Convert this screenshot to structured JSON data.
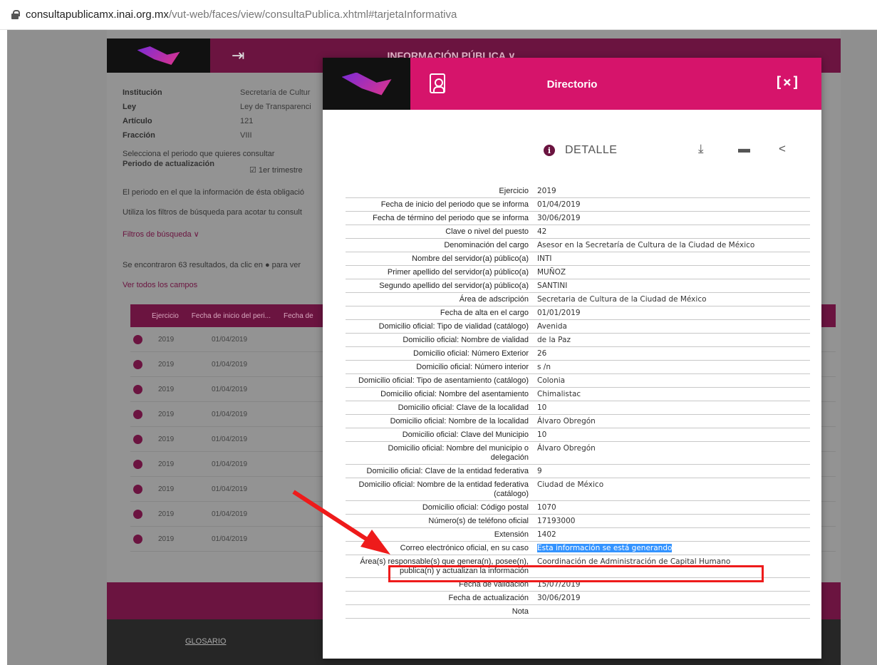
{
  "browser": {
    "url_host": "consultapublicamx.inai.org.mx",
    "url_path": "/vut-web/faces/view/consultaPublica.xhtml#tarjetaInformativa"
  },
  "background": {
    "nav_title": "INFORMACIÓN PÚBLICA ∨",
    "info_rows": [
      {
        "k": "Institución",
        "v": "Secretaría de Cultur"
      },
      {
        "k": "Ley",
        "v": "Ley de Transparenci"
      },
      {
        "k": "Artículo",
        "v": "121"
      },
      {
        "k": "Fracción",
        "v": "VIII"
      }
    ],
    "period_prompt": "Selecciona el periodo que quieres consultar",
    "period_label": "Periodo de actualización",
    "period_option": "1er trimestre",
    "obligation_text": "El periodo en el que la información de ésta obligació",
    "filters_hint": "Utiliza los filtros de búsqueda para acotar tu consult",
    "filters_link": "Filtros de búsqueda ∨",
    "results_text": "Se encontraron 63 resultados, da clic en ● para ver",
    "all_fields_link": "Ver todos los campos",
    "table_headers": [
      "Ejercicio",
      "Fecha de inicio del peri...",
      "Fecha de"
    ],
    "table_rows": [
      {
        "year": "2019",
        "date": "01/04/2019"
      },
      {
        "year": "2019",
        "date": "01/04/2019"
      },
      {
        "year": "2019",
        "date": "01/04/2019"
      },
      {
        "year": "2019",
        "date": "01/04/2019"
      },
      {
        "year": "2019",
        "date": "01/04/2019"
      },
      {
        "year": "2019",
        "date": "01/04/2019"
      },
      {
        "year": "2019",
        "date": "01/04/2019"
      },
      {
        "year": "2019",
        "date": "01/04/2019"
      },
      {
        "year": "2019",
        "date": "01/04/2019"
      }
    ],
    "glossary_link": "GLOSARIO"
  },
  "modal": {
    "title": "Directorio",
    "close_label": "[×]",
    "detail_label": "DETALLE",
    "fields": [
      {
        "label": "Ejercicio",
        "value": "2019"
      },
      {
        "label": "Fecha de inicio del periodo que se informa",
        "value": "01/04/2019"
      },
      {
        "label": "Fecha de término del periodo que se informa",
        "value": "30/06/2019"
      },
      {
        "label": "Clave o nivel del puesto",
        "value": "42"
      },
      {
        "label": "Denominación del cargo",
        "value": "Asesor en la Secretaría de Cultura de la Ciudad de México"
      },
      {
        "label": "Nombre del servidor(a) público(a)",
        "value": "INTI"
      },
      {
        "label": "Primer apellido del servidor(a) público(a)",
        "value": "MUÑOZ"
      },
      {
        "label": "Segundo apellido del servidor(a) público(a)",
        "value": "SANTINI"
      },
      {
        "label": "Área de adscripción",
        "value": "Secretaria de Cultura de la Ciudad de México"
      },
      {
        "label": "Fecha de alta en el cargo",
        "value": "01/01/2019"
      },
      {
        "label": "Domicilio oficial: Tipo de vialidad (catálogo)",
        "value": "Avenida"
      },
      {
        "label": "Domicilio oficial: Nombre de vialidad",
        "value": "de la Paz"
      },
      {
        "label": "Domicilio oficial: Número Exterior",
        "value": "26"
      },
      {
        "label": "Domicilio oficial: Número interior",
        "value": "s /n"
      },
      {
        "label": "Domicilio oficial: Tipo de asentamiento (catálogo)",
        "value": "Colonia"
      },
      {
        "label": "Domicilio oficial: Nombre del asentamiento",
        "value": "Chimalistac"
      },
      {
        "label": "Domicilio oficial: Clave de la localidad",
        "value": "10"
      },
      {
        "label": "Domicilio oficial: Nombre de la localidad",
        "value": "Álvaro Obregón"
      },
      {
        "label": "Domicilio oficial: Clave del Municipio",
        "value": "10"
      },
      {
        "label": "Domicilio oficial: Nombre del municipio o delegación",
        "value": "Álvaro Obregón"
      },
      {
        "label": "Domicilio oficial: Clave de la entidad federativa",
        "value": "9"
      },
      {
        "label": "Domicilio oficial: Nombre de la entidad federativa (catálogo)",
        "value": "Ciudad de México"
      },
      {
        "label": "Domicilio oficial: Código postal",
        "value": "1070"
      },
      {
        "label": "Número(s) de teléfono oficial",
        "value": "17193000"
      },
      {
        "label": "Extensión",
        "value": "1402"
      },
      {
        "label": "Correo electrónico oficial, en su caso",
        "value": "Esta información se está generando"
      },
      {
        "label": "Área(s) responsable(s) que genera(n), posee(n), publica(n) y actualizan la información",
        "value": "Coordinación de Administración de Capital Humano"
      },
      {
        "label": "Fecha de validación",
        "value": "15/07/2019"
      },
      {
        "label": "Fecha de actualización",
        "value": "30/06/2019"
      },
      {
        "label": "Nota",
        "value": ""
      }
    ]
  },
  "colors": {
    "brand_magenta": "#d6146b",
    "brand_dark": "#6b1440",
    "highlight": "#3393ff",
    "annotation_red": "#ee1b1b"
  },
  "icons": [
    "lock-icon",
    "directory-icon",
    "close-icon",
    "info-icon",
    "download-icon",
    "print-icon",
    "share-icon"
  ]
}
